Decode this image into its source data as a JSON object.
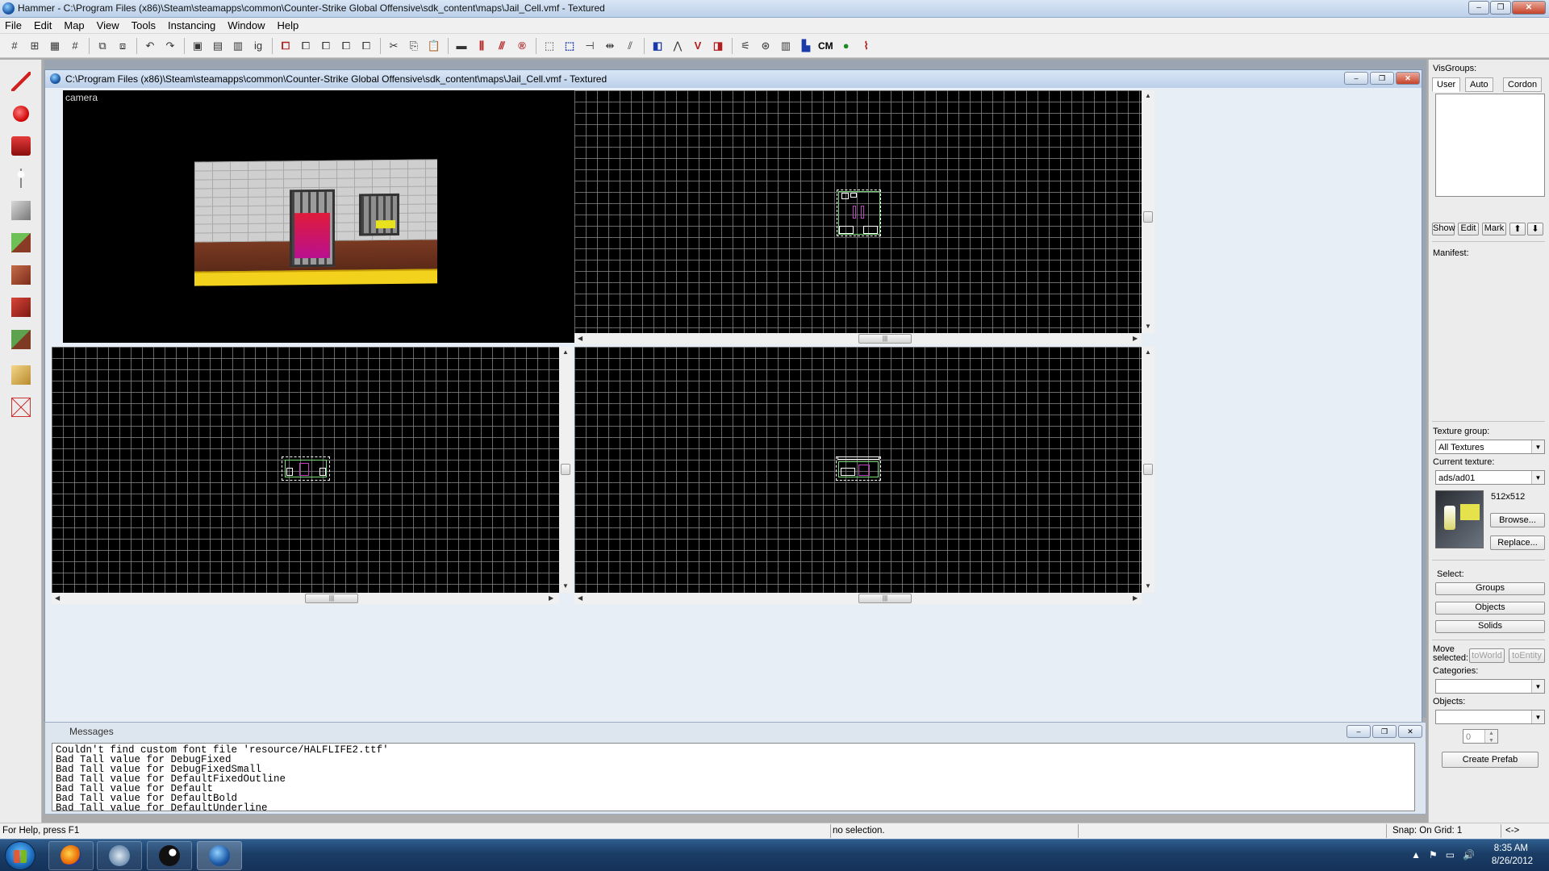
{
  "window": {
    "title": "Hammer - C:\\Program Files (x86)\\Steam\\steamapps\\common\\Counter-Strike Global Offensive\\sdk_content\\maps\\Jail_Cell.vmf - Textured"
  },
  "menu": [
    "File",
    "Edit",
    "Map",
    "View",
    "Tools",
    "Instancing",
    "Window",
    "Help"
  ],
  "toolbar": {
    "cm_label": "CM"
  },
  "document": {
    "title": "C:\\Program Files (x86)\\Steam\\steamapps\\common\\Counter-Strike Global Offensive\\sdk_content\\maps\\Jail_Cell.vmf - Textured"
  },
  "viewports": {
    "camera_label": "camera"
  },
  "messages": {
    "title": "Messages",
    "lines": [
      "Couldn't find custom font file 'resource/HALFLIFE2.ttf'",
      "Bad Tall value for DebugFixed",
      "Bad Tall value for DebugFixedSmall",
      "Bad Tall value for DefaultFixedOutline",
      "Bad Tall value for Default",
      "Bad Tall value for DefaultBold",
      "Bad Tall value for DefaultUnderline"
    ]
  },
  "rightpanel": {
    "visgroups_label": "VisGroups:",
    "tabs": [
      "User",
      "Auto",
      "Cordon"
    ],
    "vis_buttons": {
      "show": "Show",
      "edit": "Edit",
      "mark": "Mark"
    },
    "manifest_label": "Manifest:",
    "texture_group_label": "Texture group:",
    "texture_group_value": "All Textures",
    "current_texture_label": "Current texture:",
    "current_texture_value": "ads/ad01",
    "texture_size": "512x512",
    "browse": "Browse...",
    "replace": "Replace...",
    "select_label": "Select:",
    "groups": "Groups",
    "objects_btn": "Objects",
    "solids": "Solids",
    "move_selected": "Move selected:",
    "to_world": "toWorld",
    "to_entity": "toEntity",
    "categories_label": "Categories:",
    "objects_label": "Objects:",
    "count": "0",
    "create_prefab": "Create Prefab"
  },
  "status": {
    "help": "For Help, press F1",
    "selection": "no selection.",
    "snap": "Snap: On Grid: 1",
    "arrows": "<->"
  },
  "taskbar": {
    "time": "8:35 AM",
    "date": "8/26/2012"
  },
  "colors": {
    "selection_box": "#ffffff",
    "brush_outline": "#7be07b",
    "entity_outline": "#c13fc1",
    "viewport_bg": "#000000",
    "grid_line": "#8c8c8c"
  }
}
